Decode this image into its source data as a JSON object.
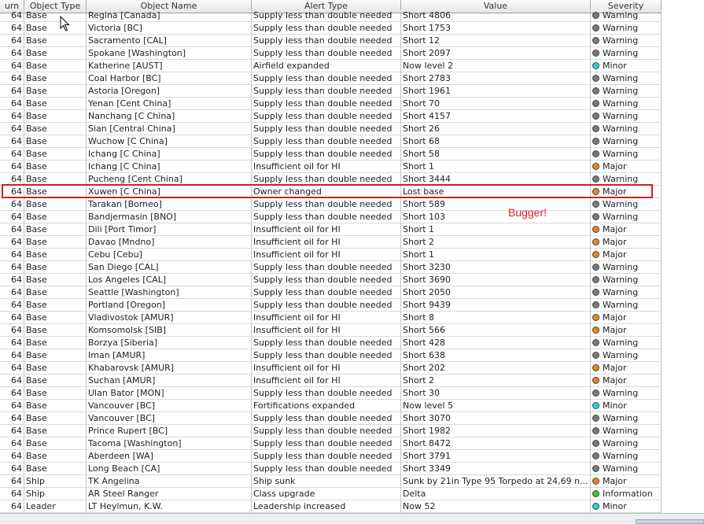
{
  "table": {
    "headers": [
      "urn",
      "Object Type",
      "Object Name",
      "Alert Type",
      "Value",
      "Severity"
    ],
    "rows": [
      [
        "64",
        "Base",
        "Regina [Canada]",
        "Supply less than double needed",
        "Short 4806",
        "Warning"
      ],
      [
        "64",
        "Base",
        "Victoria [BC]",
        "Supply less than double needed",
        "Short 1753",
        "Warning"
      ],
      [
        "64",
        "Base",
        "Sacramento [CAL]",
        "Supply less than double needed",
        "Short 12",
        "Warning"
      ],
      [
        "64",
        "Base",
        "Spokane [Washington]",
        "Supply less than double needed",
        "Short 2097",
        "Warning"
      ],
      [
        "64",
        "Base",
        "Katherine [AUST]",
        "Airfield expanded",
        "Now level 2",
        "Minor"
      ],
      [
        "64",
        "Base",
        "Coal Harbor [BC]",
        "Supply less than double needed",
        "Short 2783",
        "Warning"
      ],
      [
        "64",
        "Base",
        "Astoria [Oregon]",
        "Supply less than double needed",
        "Short 1961",
        "Warning"
      ],
      [
        "64",
        "Base",
        "Yenan [Cent China]",
        "Supply less than double needed",
        "Short 70",
        "Warning"
      ],
      [
        "64",
        "Base",
        "Nanchang [C China]",
        "Supply less than double needed",
        "Short 4157",
        "Warning"
      ],
      [
        "64",
        "Base",
        "Sian [Central China]",
        "Supply less than double needed",
        "Short 26",
        "Warning"
      ],
      [
        "64",
        "Base",
        "Wuchow [C China]",
        "Supply less than double needed",
        "Short 68",
        "Warning"
      ],
      [
        "64",
        "Base",
        "Ichang [C China]",
        "Supply less than double needed",
        "Short 58",
        "Warning"
      ],
      [
        "64",
        "Base",
        "Ichang [C China]",
        "Insufficient oil for HI",
        "Short 1",
        "Major"
      ],
      [
        "64",
        "Base",
        "Pucheng [Cent China]",
        "Supply less than double needed",
        "Short 3444",
        "Warning"
      ],
      [
        "64",
        "Base",
        "Xuwen [C China]",
        "Owner changed",
        "Lost base",
        "Major"
      ],
      [
        "64",
        "Base",
        "Tarakan [Borneo]",
        "Supply less than double needed",
        "Short 589",
        "Warning"
      ],
      [
        "64",
        "Base",
        "Bandjermasin [BNO]",
        "Supply less than double needed",
        "Short 103",
        "Warning"
      ],
      [
        "64",
        "Base",
        "Dili [Port Timor]",
        "Insufficient oil for HI",
        "Short 1",
        "Major"
      ],
      [
        "64",
        "Base",
        "Davao [Mndno]",
        "Insufficient oil for HI",
        "Short 2",
        "Major"
      ],
      [
        "64",
        "Base",
        "Cebu  [Cebu]",
        "Insufficient oil for HI",
        "Short 1",
        "Major"
      ],
      [
        "64",
        "Base",
        "San Diego [CAL]",
        "Supply less than double needed",
        "Short 3230",
        "Warning"
      ],
      [
        "64",
        "Base",
        "Los Angeles [CAL]",
        "Supply less than double needed",
        "Short 3690",
        "Warning"
      ],
      [
        "64",
        "Base",
        "Seattle [Washington]",
        "Supply less than double needed",
        "Short 2050",
        "Warning"
      ],
      [
        "64",
        "Base",
        "Portland [Oregon]",
        "Supply less than double needed",
        "Short 9439",
        "Warning"
      ],
      [
        "64",
        "Base",
        "Vladivostok [AMUR]",
        "Insufficient oil for HI",
        "Short 8",
        "Major"
      ],
      [
        "64",
        "Base",
        "Komsomolsk [SIB]",
        "Insufficient oil for HI",
        "Short 566",
        "Major"
      ],
      [
        "64",
        "Base",
        "Borzya [Siberia]",
        "Supply less than double needed",
        "Short 428",
        "Warning"
      ],
      [
        "64",
        "Base",
        "Iman [AMUR]",
        "Supply less than double needed",
        "Short 638",
        "Warning"
      ],
      [
        "64",
        "Base",
        "Khabarovsk [AMUR]",
        "Insufficient oil for HI",
        "Short 202",
        "Major"
      ],
      [
        "64",
        "Base",
        "Suchan [AMUR]",
        "Insufficient oil for HI",
        "Short 2",
        "Major"
      ],
      [
        "64",
        "Base",
        "Ulan Bator [MON]",
        "Supply less than double needed",
        "Short 30",
        "Warning"
      ],
      [
        "64",
        "Base",
        "Vancouver [BC]",
        "Fortifications expanded",
        "Now level 5",
        "Minor"
      ],
      [
        "64",
        "Base",
        "Vancouver [BC]",
        "Supply less than double needed",
        "Short 3070",
        "Warning"
      ],
      [
        "64",
        "Base",
        "Prince Rupert [BC]",
        "Supply less than double needed",
        "Short 1982",
        "Warning"
      ],
      [
        "64",
        "Base",
        "Tacoma [Washington]",
        "Supply less than double needed",
        "Short 8472",
        "Warning"
      ],
      [
        "64",
        "Base",
        "Aberdeen [WA]",
        "Supply less than double needed",
        "Short 3791",
        "Warning"
      ],
      [
        "64",
        "Base",
        "Long Beach [CA]",
        "Supply less than double needed",
        "Short 3349",
        "Warning"
      ],
      [
        "64",
        "Ship",
        "TK Angelina",
        "Ship sunk",
        "Sunk by 21in Type 95 Torpedo at 24,69 n...",
        "Major"
      ],
      [
        "64",
        "Ship",
        "AR Steel Ranger",
        "Class upgrade",
        "Delta",
        "Information"
      ],
      [
        "64",
        "Leader",
        "LT Heylmun, K.W.",
        "Leadership increased",
        "Now 52",
        "Minor"
      ]
    ]
  },
  "severity_colors": {
    "Warning": "#7a7a7a",
    "Minor": "#22d6d6",
    "Major": "#e8871c",
    "Information": "#2ecc2e"
  },
  "annotation": {
    "note": "Bugger!",
    "highlight_color": "#cc2222"
  }
}
